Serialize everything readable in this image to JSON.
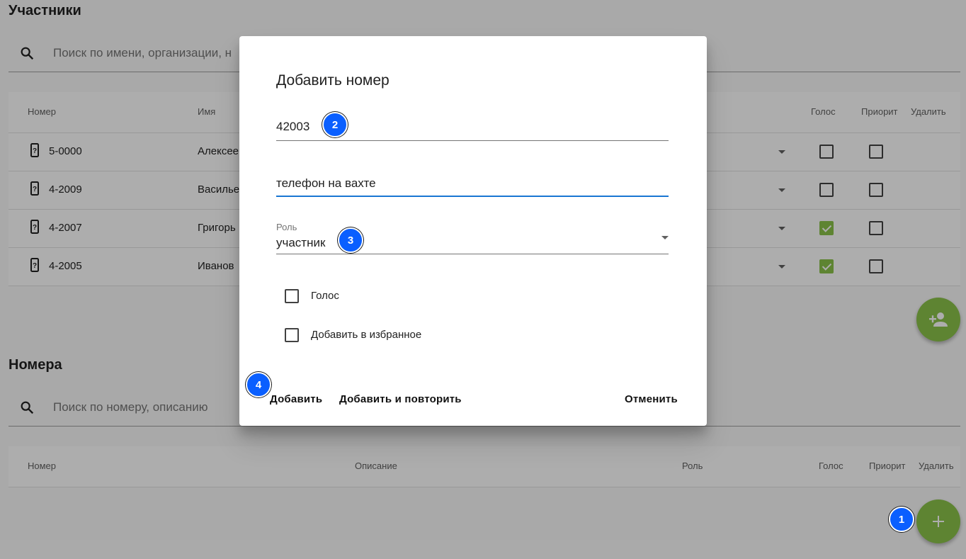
{
  "participants": {
    "title": "Участники",
    "search_placeholder": "Поиск по имени, организации, н",
    "columns": {
      "number": "Номер",
      "name": "Имя",
      "voice": "Голос",
      "priority": "Приорит",
      "delete": "Удалить"
    },
    "rows": [
      {
        "number": "5-0000",
        "name": "Алексее",
        "voice": false,
        "priority": false
      },
      {
        "number": "4-2009",
        "name": "Василье",
        "voice": false,
        "priority": false
      },
      {
        "number": "4-2007",
        "name": "Григорь",
        "voice": true,
        "priority": false
      },
      {
        "number": "4-2005",
        "name": "Иванов",
        "voice": true,
        "priority": false
      }
    ]
  },
  "numbers": {
    "title": "Номера",
    "search_placeholder": "Поиск по номеру, описанию",
    "columns": {
      "number": "Номер",
      "description": "Описание",
      "role": "Роль",
      "voice": "Голос",
      "priority": "Приорит",
      "delete": "Удалить"
    }
  },
  "dialog": {
    "title": "Добавить номер",
    "number_value": "42003",
    "description_value": "телефон на вахте",
    "role_label": "Роль",
    "role_value": "участник",
    "voice_label": "Голос",
    "favorite_label": "Добавить в избранное",
    "add_button": "Добавить",
    "add_repeat_button": "Добавить и повторить",
    "cancel_button": "Отменить"
  },
  "badges": {
    "b1": "1",
    "b2": "2",
    "b3": "3",
    "b4": "4"
  },
  "colors": {
    "accent": "#8bc34a",
    "badge": "#0a5fff",
    "focus": "#1976d2"
  },
  "icons": {
    "search": "search-icon",
    "phone": "phone-icon",
    "add_person": "person-add-icon",
    "add": "plus-icon",
    "dropdown": "dropdown-arrow-icon"
  }
}
